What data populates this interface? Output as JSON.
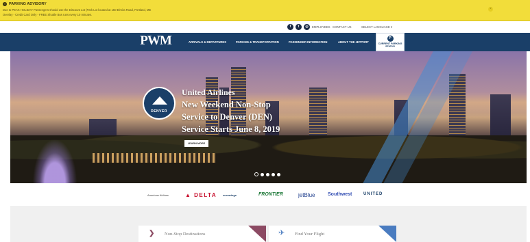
{
  "advisory": {
    "title": "PARKING ADVISORY",
    "line1": "Due to PEAK HOLIDAY Passengers should use the Discount Lot (Park Lot located at 150 Elmira Road, Portland, ME",
    "line2": "Overlay - Credit Card Only - FREE Shuttle Bus runs every 10 minutes.",
    "icon": "warning-icon"
  },
  "utility": {
    "social": [
      "facebook-icon",
      "twitter-icon",
      "instagram-icon"
    ],
    "links": [
      "EMPLOYEES",
      "CONTACT US",
      "SELECT LANGUAGE ▾"
    ]
  },
  "nav": {
    "logo": "PWM",
    "logo_sub": "Portland International Jetport",
    "items": [
      "ARRIVALS & DEPARTURES",
      "PARKING & TRANSPORTATION",
      "PASSENGER INFORMATION",
      "ABOUT THE JETPORT"
    ],
    "parking_button": "CURRENT PARKING STATUS"
  },
  "hero": {
    "badge_text": "DENVER",
    "lines": [
      "United Airlines",
      "New Weekend Non-Stop",
      "Service to Denver (DEN)",
      "Service Starts June 8, 2019"
    ],
    "button": "LEARN MORE",
    "slides": 5,
    "active_slide": 1
  },
  "airlines": [
    "American Airlines",
    "DELTA",
    "eurowings",
    "FRONTIER",
    "jetBlue",
    "Southwest",
    "UNITED"
  ],
  "cards": [
    {
      "label": "Non-Stop Destinations",
      "icon": "chevron-right-icon"
    },
    {
      "label": "Find Your Flight",
      "icon": "plane-icon"
    }
  ],
  "colors": {
    "advisory_bg": "#f2dd3a",
    "nav_bg": "#1a3f68",
    "card_accent_1": "#8c4a63",
    "card_accent_2": "#4a7cc0"
  }
}
